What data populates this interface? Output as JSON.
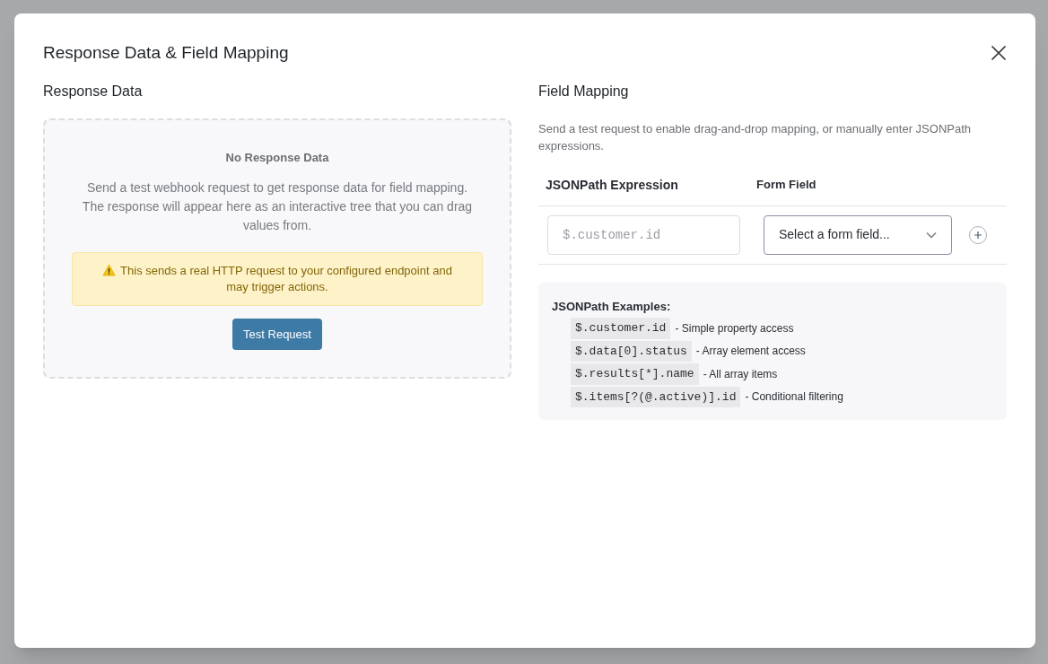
{
  "dialog": {
    "title": "Response Data & Field Mapping"
  },
  "response_panel": {
    "heading": "Response Data",
    "empty_title": "No Response Data",
    "empty_text": "Send a test webhook request to get response data for field mapping. The response will appear here as an interactive tree that you can drag values from.",
    "warning": "This sends a real HTTP request to your configured endpoint and may trigger actions.",
    "button": "Test Request"
  },
  "mapping_panel": {
    "heading": "Field Mapping",
    "description": "Send a test request to enable drag-and-drop mapping, or manually enter JSONPath expressions.",
    "columns": [
      "JSONPath Expression",
      "Form Field"
    ],
    "rows": [
      {
        "path_placeholder": "$.customer.id",
        "field_select": "Select a form field..."
      }
    ],
    "examples_title": "JSONPath Examples:",
    "examples": [
      {
        "code": "$.customer.id",
        "text": "- Simple property access"
      },
      {
        "code": "$.data[0].status",
        "text": "- Array element access"
      },
      {
        "code": "$.results[*].name",
        "text": "- All array items"
      },
      {
        "code": "$.items[?(@.active)].id",
        "text": "- Conditional filtering"
      }
    ]
  }
}
